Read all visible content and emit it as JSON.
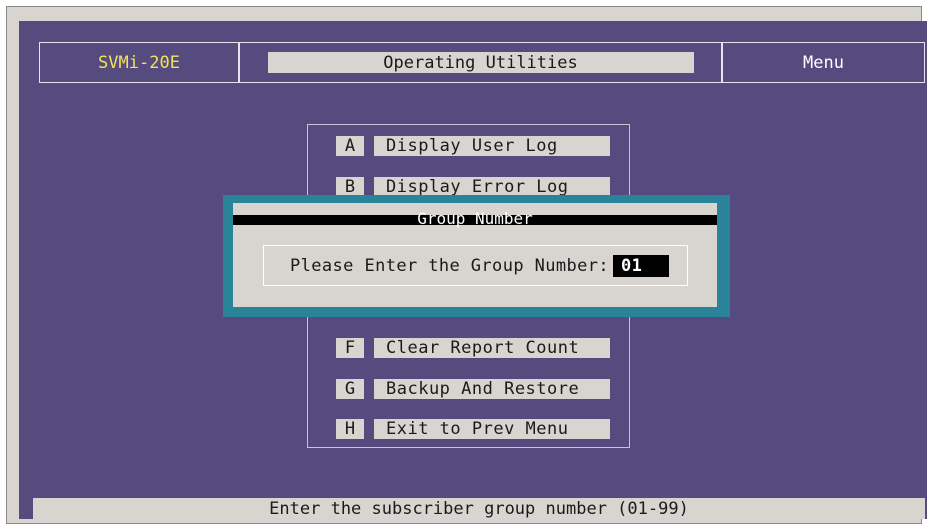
{
  "header": {
    "model": "SVMi-20E",
    "title": "Operating Utilities",
    "menu": "Menu"
  },
  "menu": {
    "items": [
      {
        "key": "A",
        "label": "Display User Log"
      },
      {
        "key": "B",
        "label": "Display Error Log"
      },
      {
        "key": "F",
        "label": "Clear Report Count"
      },
      {
        "key": "G",
        "label": "Backup And Restore"
      },
      {
        "key": "H",
        "label": "Exit to Prev Menu"
      }
    ]
  },
  "dialog": {
    "title": "Group Number",
    "prompt": "Please Enter the Group Number:",
    "value": "01"
  },
  "status": {
    "text": "Enter the subscriber group number (01-99)"
  },
  "colors": {
    "screen_bg": "#564b7f",
    "model_text": "#f3e15a",
    "dialog_border": "#2a8499",
    "panel_gray": "#d8d4cf"
  }
}
